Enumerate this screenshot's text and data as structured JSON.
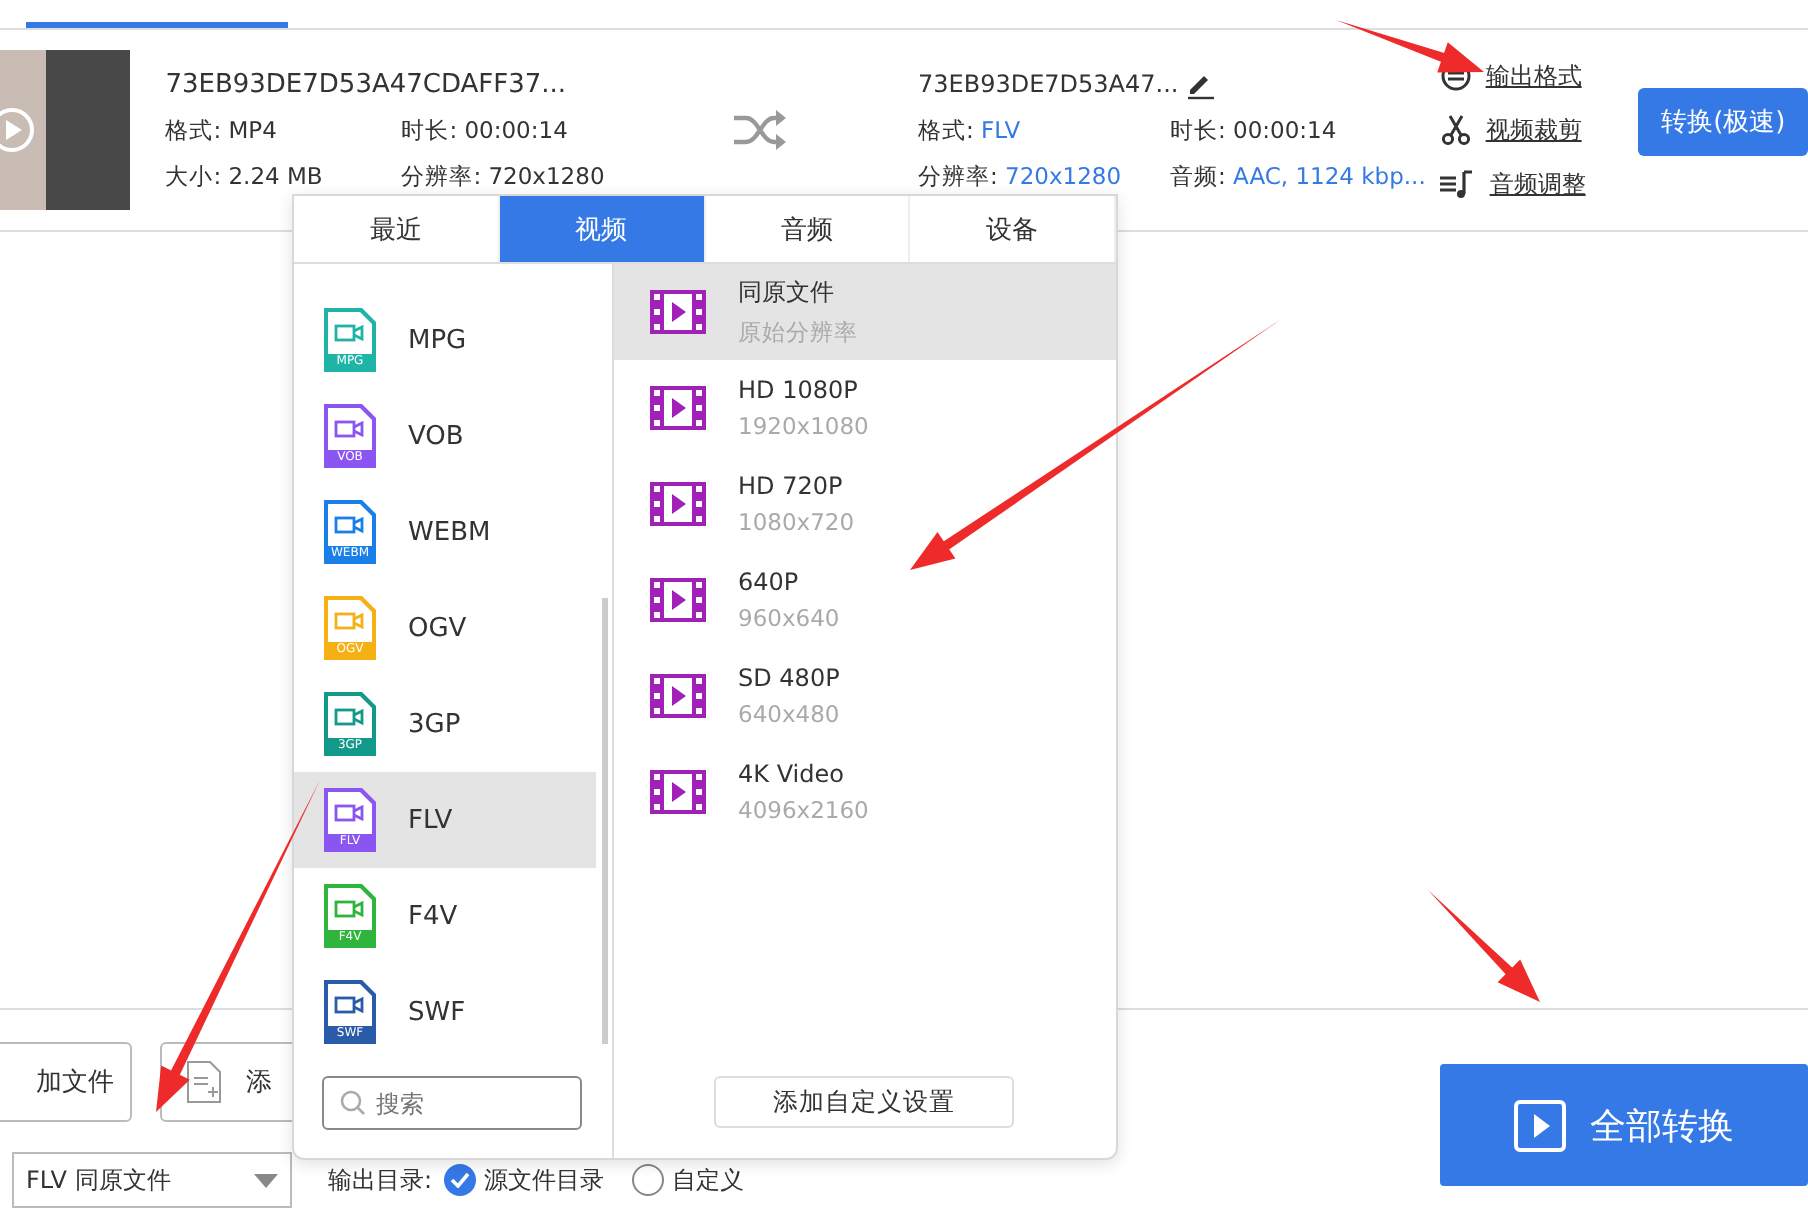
{
  "source": {
    "name": "73EB93DE7D53A47CDAFF37...",
    "fields": [
      {
        "label": "格式:",
        "value": "MP4"
      },
      {
        "label": "时长:",
        "value": "00:00:14"
      },
      {
        "label": "大小:",
        "value": "2.24 MB"
      },
      {
        "label": "分辨率:",
        "value": "720x1280"
      }
    ]
  },
  "output": {
    "name": "73EB93DE7D53A47...",
    "fields": [
      {
        "label": "格式:",
        "value": "FLV",
        "changed": true
      },
      {
        "label": "时长:",
        "value": "00:00:14",
        "changed": false
      },
      {
        "label": "分辨率:",
        "value": "720x1280",
        "changed": true
      },
      {
        "label": "音频:",
        "value": "AAC, 1124 kbp...",
        "changed": true
      }
    ]
  },
  "actions": [
    {
      "kind": "format",
      "label": "输出格式"
    },
    {
      "kind": "cut",
      "label": "视频裁剪"
    },
    {
      "kind": "audio",
      "label": "音频调整"
    }
  ],
  "convert_button": "转换(极速)",
  "popup": {
    "tabs": [
      {
        "label": "最近",
        "selected": false
      },
      {
        "label": "视频",
        "selected": true
      },
      {
        "label": "音频",
        "selected": false
      },
      {
        "label": "设备",
        "selected": false
      }
    ],
    "formats": [
      {
        "label": "MPG",
        "badge": "MPG",
        "color": "#1fb5a6",
        "selected": false
      },
      {
        "label": "VOB",
        "badge": "VOB",
        "color": "#8a55f0",
        "selected": false
      },
      {
        "label": "WEBM",
        "badge": "WEBM",
        "color": "#1a7fe8",
        "selected": false
      },
      {
        "label": "OGV",
        "badge": "OGV",
        "color": "#f5b014",
        "selected": false
      },
      {
        "label": "3GP",
        "badge": "3GP",
        "color": "#12998a",
        "selected": false
      },
      {
        "label": "FLV",
        "badge": "FLV",
        "color": "#8a55f0",
        "selected": true
      },
      {
        "label": "F4V",
        "badge": "F4V",
        "color": "#2fb53c",
        "selected": false
      },
      {
        "label": "SWF",
        "badge": "SWF",
        "color": "#2a5ba8",
        "selected": false
      }
    ],
    "presets": [
      {
        "title": "同原文件",
        "subtitle": "原始分辨率",
        "selected": true
      },
      {
        "title": "HD 1080P",
        "subtitle": "1920x1080",
        "selected": false
      },
      {
        "title": "HD 720P",
        "subtitle": "1080x720",
        "selected": false
      },
      {
        "title": "640P",
        "subtitle": "960x640",
        "selected": false
      },
      {
        "title": "SD 480P",
        "subtitle": "640x480",
        "selected": false
      },
      {
        "title": "4K Video",
        "subtitle": "4096x2160",
        "selected": false
      }
    ],
    "search": {
      "placeholder": "搜索"
    },
    "add_custom": "添加自定义设置"
  },
  "bottom": {
    "add_file": "加文件",
    "add_folder": "添",
    "output_select": "FLV 同原文件",
    "output_dir_label": "输出目录:",
    "output_dir_options": [
      {
        "label": "源文件目录",
        "selected": true
      },
      {
        "label": "自定义",
        "selected": false
      }
    ],
    "convert_all": "全部转换"
  }
}
